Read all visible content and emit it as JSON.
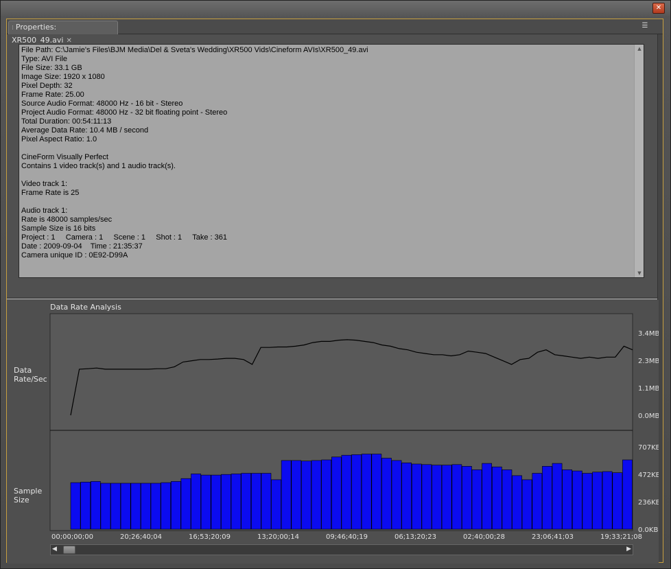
{
  "window": {
    "close_glyph": "✕"
  },
  "tab": {
    "label": "Properties: XR500_49.avi",
    "close_glyph": "✕",
    "grip_glyph": "⁞"
  },
  "panel_menu_glyph": "☰",
  "properties_lines": [
    "File Path: C:\\Jamie's Files\\BJM Media\\Del & Sveta's Wedding\\XR500 Vids\\Cineform AVIs\\XR500_49.avi",
    "Type: AVI File",
    "File Size: 33.1 GB",
    "Image Size: 1920 x 1080",
    "Pixel Depth: 32",
    "Frame Rate: 25.00",
    "Source Audio Format: 48000 Hz - 16 bit - Stereo",
    "Project Audio Format: 48000 Hz - 32 bit floating point - Stereo",
    "Total Duration: 00:54:11:13",
    "Average Data Rate: 10.4 MB / second",
    "Pixel Aspect Ratio: 1.0",
    "",
    "CineForm Visually Perfect",
    "Contains 1 video track(s) and 1 audio track(s).",
    "",
    "Video track 1:",
    "Frame Rate is 25",
    "",
    "Audio track 1:",
    "Rate is 48000 samples/sec",
    "Sample Size is 16 bits",
    "Project : 1     Camera : 1     Scene : 1     Shot : 1     Take : 361",
    "Date : 2009-09-04    Time : 21:35:37",
    "Camera unique ID : 0E92-D99A"
  ],
  "analysis": {
    "title": "Data Rate Analysis",
    "rate_label_line1": "Data",
    "rate_label_line2": "Rate/Sec",
    "sample_label_line1": "Sample",
    "sample_label_line2": "Size"
  },
  "colors": {
    "bar_fill": "#0b0bf0",
    "line": "#000000",
    "chart_bg": "#595959"
  },
  "chart_data": [
    {
      "type": "line",
      "ylabel": "Data Rate/Sec",
      "yticks": [
        "0.0MB",
        "1.1MB",
        "2.3MB",
        "3.4MB"
      ],
      "ylim": [
        0,
        3.4
      ],
      "values": [
        0.0,
        1.9,
        1.92,
        1.95,
        1.9,
        1.9,
        1.9,
        1.9,
        1.9,
        1.9,
        1.92,
        1.92,
        2.0,
        2.2,
        2.25,
        2.3,
        2.3,
        2.32,
        2.35,
        2.35,
        2.3,
        2.1,
        2.8,
        2.8,
        2.82,
        2.82,
        2.85,
        2.9,
        3.0,
        3.05,
        3.05,
        3.1,
        3.12,
        3.1,
        3.05,
        3.0,
        2.9,
        2.85,
        2.75,
        2.7,
        2.6,
        2.55,
        2.5,
        2.5,
        2.45,
        2.5,
        2.65,
        2.6,
        2.55,
        2.4,
        2.25,
        2.1,
        2.3,
        2.35,
        2.6,
        2.7,
        2.5,
        2.45,
        2.4,
        2.35,
        2.4,
        2.35,
        2.4,
        2.4,
        2.85,
        2.7
      ],
      "grid": false
    },
    {
      "type": "bar",
      "ylabel": "Sample Size",
      "yticks": [
        "0.0KB",
        "236KB",
        "472KB",
        "707KB"
      ],
      "ylim": [
        0,
        707
      ],
      "values": [
        400,
        405,
        410,
        395,
        395,
        395,
        395,
        395,
        395,
        400,
        410,
        435,
        475,
        465,
        465,
        470,
        475,
        480,
        480,
        480,
        425,
        590,
        590,
        585,
        590,
        595,
        620,
        635,
        640,
        645,
        645,
        610,
        590,
        570,
        560,
        555,
        550,
        550,
        555,
        540,
        510,
        565,
        535,
        510,
        460,
        425,
        480,
        540,
        565,
        510,
        500,
        480,
        490,
        495,
        485,
        595
      ],
      "xticks": [
        "00;00;00;00",
        "20;26;40;04",
        "16;53;20;09",
        "13;20;00;14",
        "09;46;40;19",
        "06;13;20;23",
        "02;40;00;28",
        "23;06;41;03",
        "19;33;21;08"
      ],
      "grid": false
    }
  ]
}
